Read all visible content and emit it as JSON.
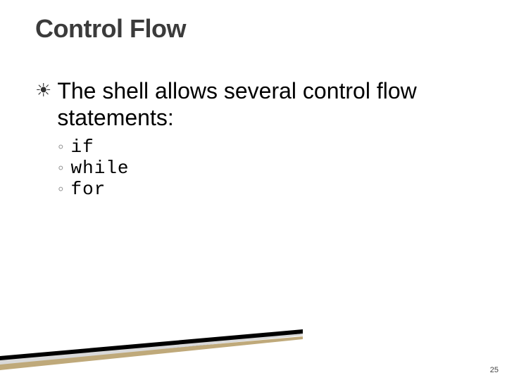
{
  "title": "Control Flow",
  "main": {
    "bullet": "☀",
    "text": "The shell allows several control flow statements:"
  },
  "subs": {
    "bullet": "◦",
    "items": [
      "if",
      "while",
      "for"
    ]
  },
  "pageNumber": "25"
}
